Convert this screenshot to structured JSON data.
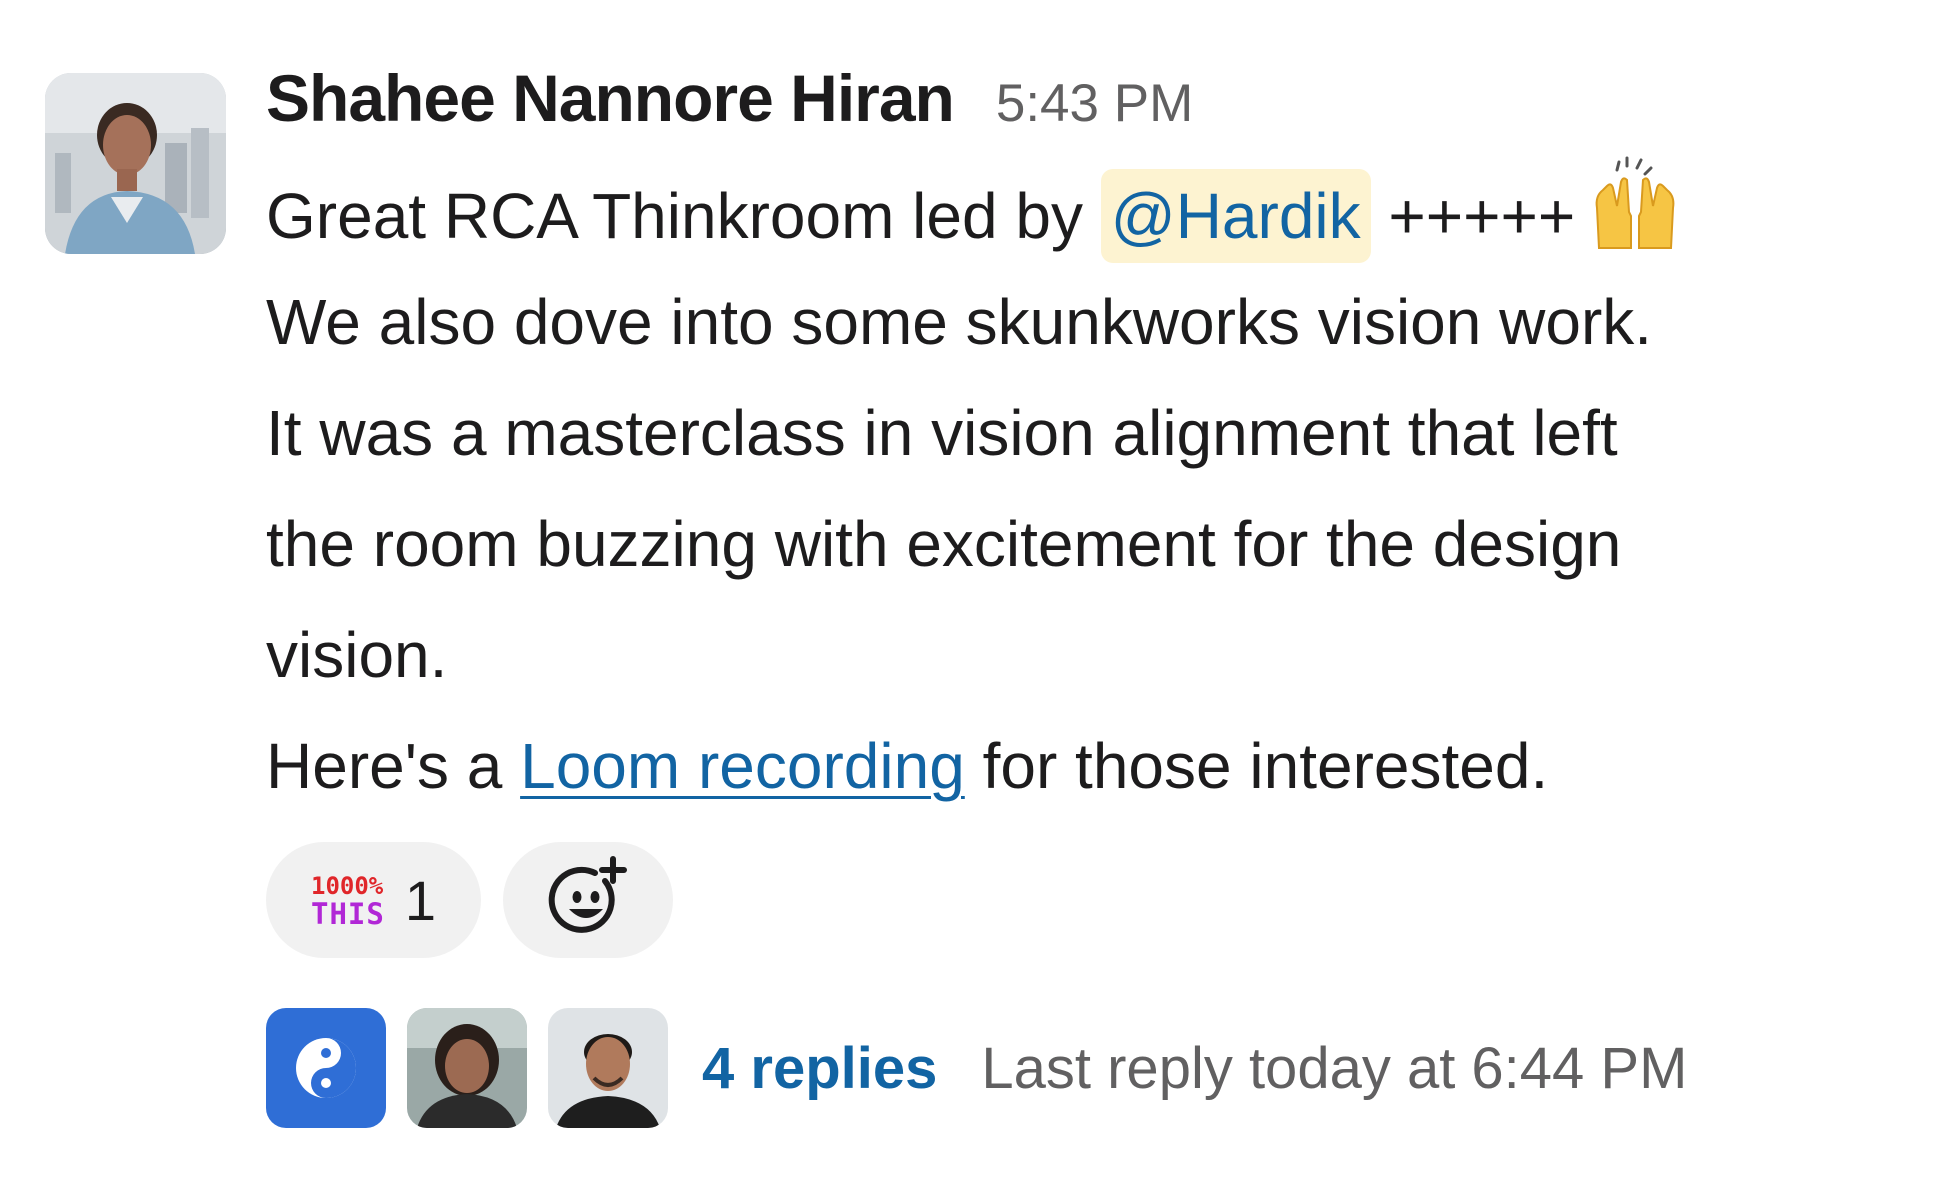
{
  "message": {
    "sender": "Shahee Nannore Hiran",
    "timestamp": "5:43 PM",
    "line1_before": "Great RCA Thinkroom led by ",
    "mention": "@Hardik",
    "line1_after": " +++++",
    "line1_emoji": "raised-hands-emoji",
    "line2": "We also dove into some skunkworks vision work.",
    "line3": "It was a masterclass in vision alignment that left",
    "line4": "the room buzzing with excitement for the design",
    "line5": "vision.",
    "line6_before": "Here's a ",
    "link_text": "Loom recording",
    "line6_after": " for those interested."
  },
  "reactions": [
    {
      "emoji_top": "1000%",
      "emoji_bottom": "THIS",
      "count": "1"
    }
  ],
  "add_reaction_icon": "add-reaction-icon",
  "thread": {
    "replies": "4 replies",
    "last_reply": "Last reply today at 6:44 PM"
  },
  "colors": {
    "link": "#1264a3",
    "mention_bg": "#fdf3d1",
    "muted_text": "#616061",
    "pill_bg": "#f1f1f1"
  }
}
